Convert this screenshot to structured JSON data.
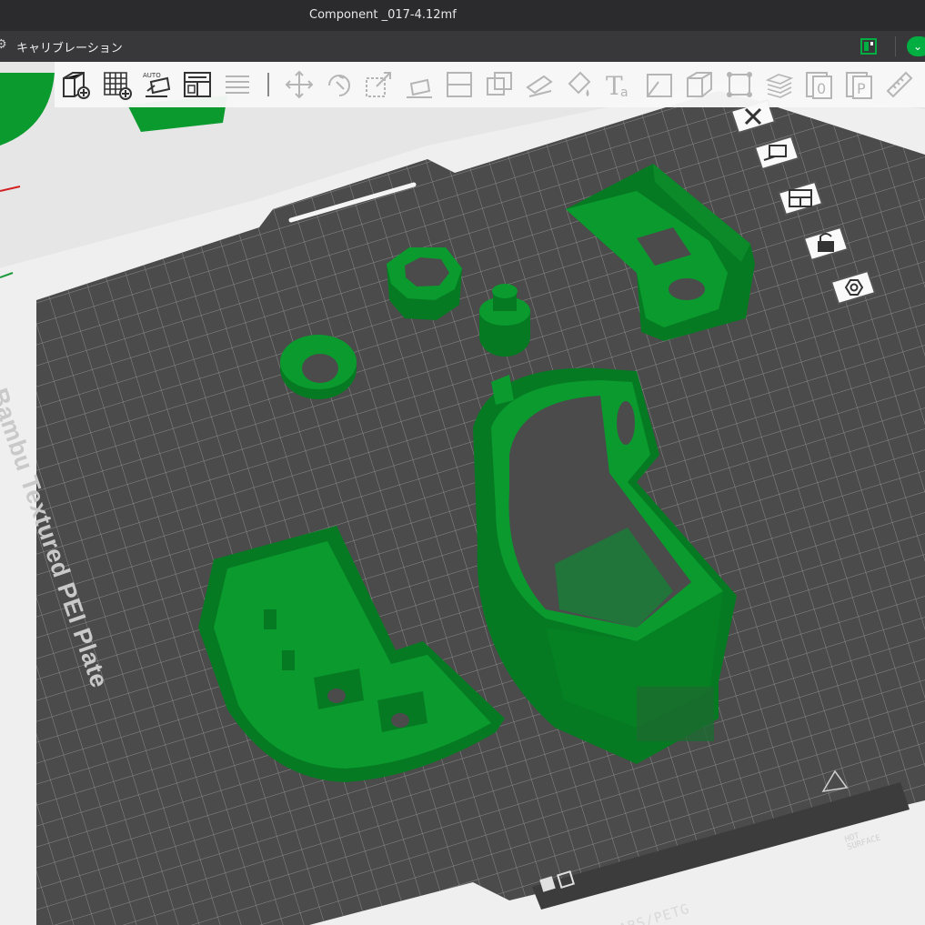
{
  "window": {
    "title": "Component _017-4.12mf"
  },
  "menubar": {
    "label": "キャリブレーション",
    "gear_icon": "gear-icon",
    "layout_icon": "layout-icon",
    "sync_icon": "chevron-down-icon"
  },
  "toolbar": {
    "left_tools": [
      "add-object-icon",
      "add-plate-icon",
      "auto-orient-icon",
      "arrange-icon",
      "split-layers-icon"
    ],
    "right_tools": [
      "move-icon",
      "rotate-icon",
      "scale-icon",
      "lay-on-face-icon",
      "cut-icon",
      "boolean-icon",
      "support-paint-icon",
      "color-paint-icon",
      "text-icon",
      "seam-paint-icon",
      "mesh-view-icon",
      "assembly-icon",
      "variable-layer-icon",
      "object-zero-icon",
      "plate-sliced-icon",
      "measure-icon"
    ]
  },
  "plate_controls": [
    "close-plate-icon",
    "auto-orient-plate-icon",
    "arrange-plate-icon",
    "lock-plate-icon",
    "plate-settings-icon"
  ],
  "plate": {
    "label": "Bambu Textured PEI Plate",
    "filament_label": "PLA/ABS/PETG",
    "hot_surface_label": "HOT\nSURFACE"
  },
  "colors": {
    "model": "#0a9a2e",
    "model_dark": "#067a22",
    "plate": "#4b4b4b",
    "grid": "#8a8a8a",
    "accent": "#00ae42"
  }
}
